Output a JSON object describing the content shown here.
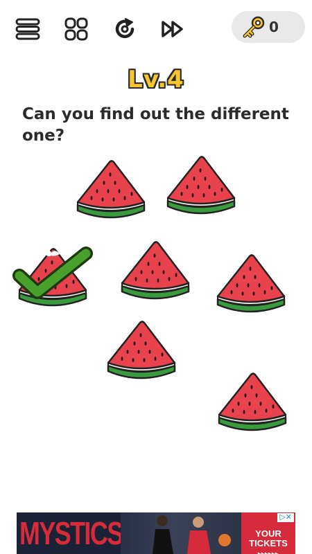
{
  "toolbar": {
    "menu_icon": "menu-icon",
    "levels_icon": "levels-grid-icon",
    "restart_icon": "restart-icon",
    "skip_icon": "skip-icon",
    "keys_icon": "key-icon",
    "keys_count": "0"
  },
  "level": {
    "title": "Lv.4"
  },
  "question": "Can you find out the different one?",
  "puzzle": {
    "item_icon": "watermelon-slice-icon",
    "selected_item": "watermelon-left-middle (bitten)",
    "result_icon": "checkmark-icon",
    "colors": {
      "flesh": "#e8434c",
      "rind": "#3a9b3e",
      "seeds": "#2a1a1a",
      "check": "#4aa02c"
    }
  },
  "ad": {
    "brand": "MYSTICS",
    "cta": "YOUR TICKETS",
    "cta_arrows": "▸▸▸▸▸▸",
    "choices_icon": "ad-choices-icon"
  }
}
